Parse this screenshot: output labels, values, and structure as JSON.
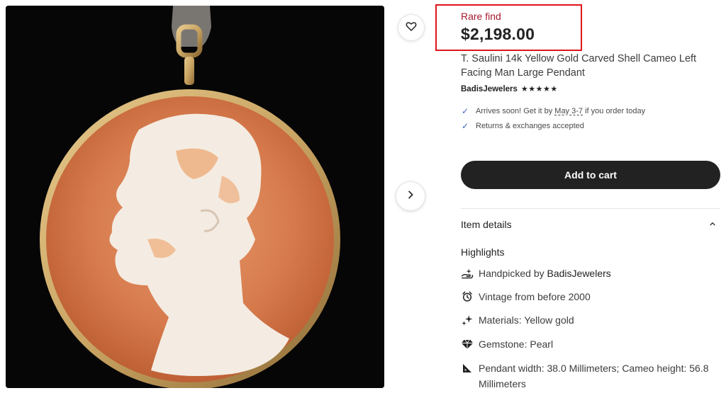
{
  "product": {
    "badge": "Rare find",
    "price": "$2,198.00",
    "title": "T. Saulini 14k Yellow Gold Carved Shell Cameo Left Facing Man Large Pendant",
    "shop": "BadisJewelers",
    "rating_stars": "★★★★★",
    "rating": 5
  },
  "perks": {
    "arrival_prefix": "Arrives soon! Get it by",
    "arrival_date": "May 3-7",
    "arrival_suffix": "if you order today",
    "returns": "Returns & exchanges accepted"
  },
  "actions": {
    "add_to_cart": "Add to cart"
  },
  "details": {
    "header": "Item details",
    "highlights_title": "Highlights",
    "handpicked_prefix": "Handpicked by",
    "handpicked_shop": "BadisJewelers",
    "vintage": "Vintage from before 2000",
    "materials": "Materials: Yellow gold",
    "gemstone": "Gemstone: Pearl",
    "dimensions": "Pendant width: 38.0 Millimeters; Cameo height: 56.8 Millimeters"
  },
  "icons": {
    "favorite": "heart-icon",
    "next": "chevron-right-icon",
    "check": "check-icon",
    "collapse": "chevron-up-icon",
    "handpicked": "hand-sparkle-icon",
    "vintage": "alarm-clock-icon",
    "materials": "sparkle-icon",
    "gemstone": "diamond-icon",
    "dimensions": "ruler-triangle-icon"
  },
  "colors": {
    "rare_find": "#a61a2e",
    "highlight_box": "#e0141b",
    "button": "#222222",
    "check": "#3b67c4"
  }
}
